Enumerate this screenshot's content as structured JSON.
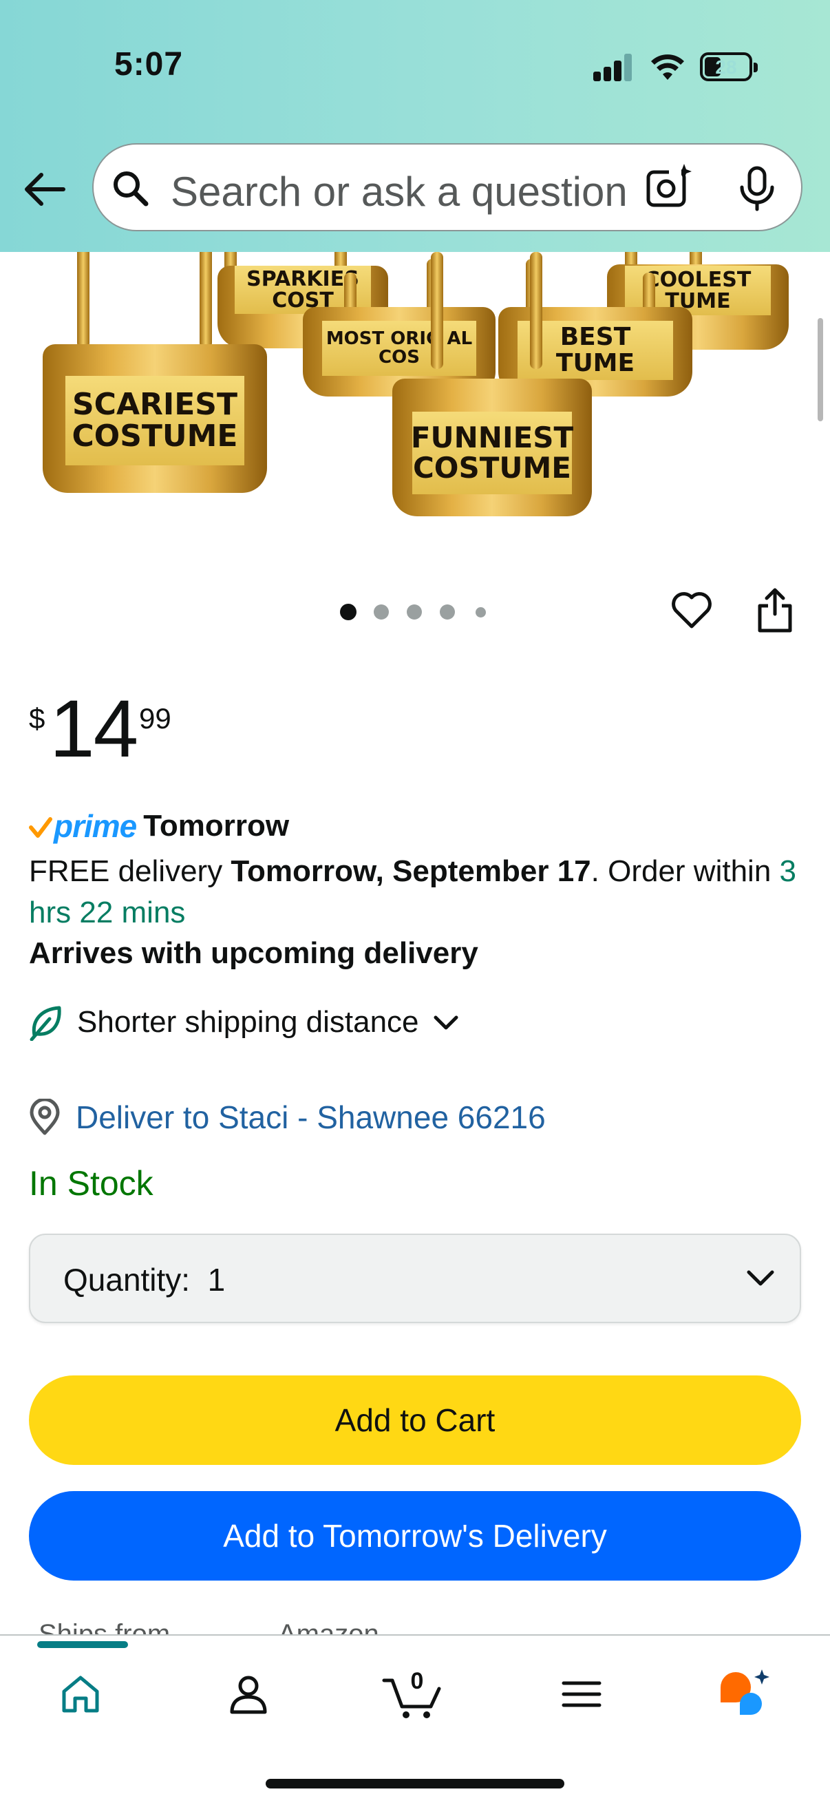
{
  "status_bar": {
    "time": "5:07",
    "battery_level": "28"
  },
  "header": {
    "back_label": "Back",
    "search_placeholder": "Search or ask a question"
  },
  "product_image": {
    "trophies": [
      {
        "label": "SPARKIES COST"
      },
      {
        "label": "COOLEST TUME"
      },
      {
        "label": "MOST ORIG AL COS"
      },
      {
        "label": "BEST TUME"
      },
      {
        "label": "SCARIEST COSTUME"
      },
      {
        "label": "FUNNIEST COSTUME"
      }
    ],
    "carousel_total": 5,
    "carousel_active": 1
  },
  "price": {
    "symbol": "$",
    "whole": "14",
    "fraction": "99"
  },
  "delivery": {
    "prime_word": "prime",
    "prime_label": "Tomorrow",
    "free_prefix": "FREE delivery ",
    "date": "Tomorrow, September 17",
    "order_within": ". Order within ",
    "countdown": "3 hrs 22 mins",
    "arrives": "Arrives with upcoming delivery",
    "shorter_shipping": "Shorter shipping distance",
    "deliver_to": "Deliver to Staci - Shawnee 66216"
  },
  "stock_status": "In Stock",
  "quantity": {
    "label": "Quantity:",
    "value": "1"
  },
  "buttons": {
    "add_to_cart": "Add to Cart",
    "add_to_delivery": "Add to Tomorrow's Delivery"
  },
  "ships_from": {
    "label": "Ships from",
    "value": "Amazon"
  },
  "bottom_nav": {
    "items": [
      "home-icon",
      "account-icon",
      "cart-icon",
      "menu-icon",
      "rufus-icon"
    ],
    "cart_count": "0"
  },
  "colors": {
    "accent_teal": "#067d85",
    "prime_blue": "#1a98ff",
    "cart_yellow": "#ffd814",
    "delivery_blue": "#0066ff",
    "stock_green": "#007600",
    "link_blue": "#2162a1"
  }
}
